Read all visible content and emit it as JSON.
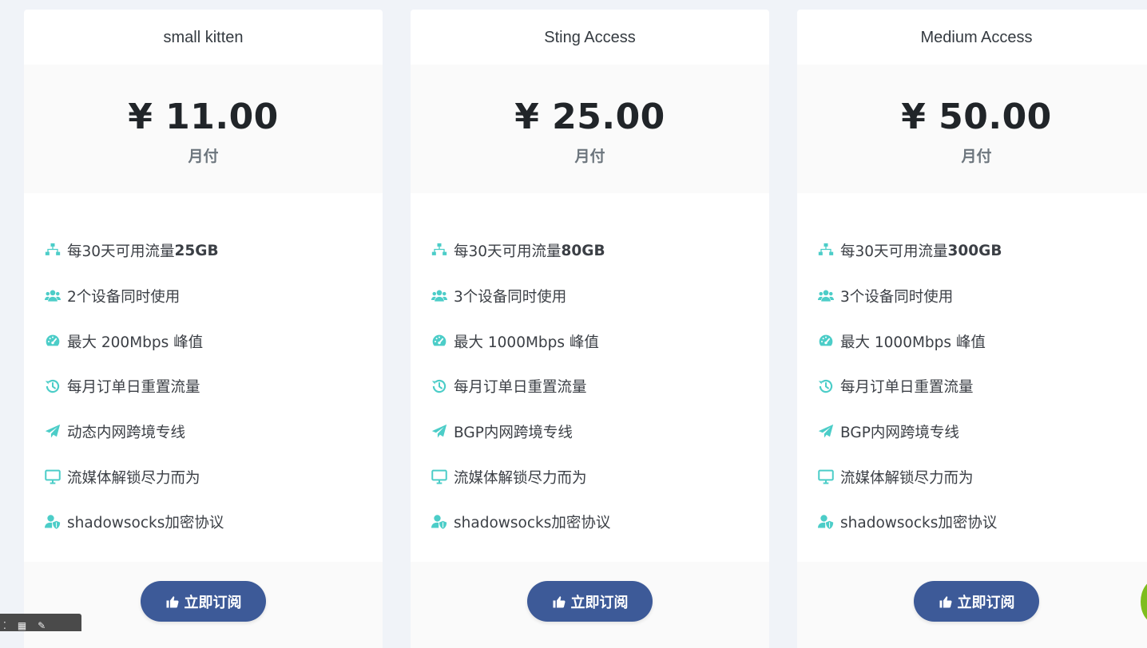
{
  "accent_color": "#4ccdc8",
  "button_color": "#3d5a98",
  "plans": [
    {
      "name": "small kitten",
      "price": "¥ 11.00",
      "period": "月付",
      "features": [
        {
          "icon": "network-icon",
          "text": "每30天可用流量",
          "bold": "25GB"
        },
        {
          "icon": "users-icon",
          "text": "2个设备同时使用",
          "bold": ""
        },
        {
          "icon": "speedometer-icon",
          "text": "最大 200Mbps 峰值",
          "bold": ""
        },
        {
          "icon": "history-icon",
          "text": "每月订单日重置流量",
          "bold": ""
        },
        {
          "icon": "paper-plane-icon",
          "text": "动态内网跨境专线",
          "bold": ""
        },
        {
          "icon": "monitor-icon",
          "text": "流媒体解锁尽力而为",
          "bold": ""
        },
        {
          "icon": "user-shield-icon",
          "text": "shadowsocks加密协议",
          "bold": ""
        }
      ],
      "button": "立即订阅"
    },
    {
      "name": "Sting Access",
      "price": "¥ 25.00",
      "period": "月付",
      "features": [
        {
          "icon": "network-icon",
          "text": "每30天可用流量",
          "bold": "80GB"
        },
        {
          "icon": "users-icon",
          "text": "3个设备同时使用",
          "bold": ""
        },
        {
          "icon": "speedometer-icon",
          "text": "最大 1000Mbps 峰值",
          "bold": ""
        },
        {
          "icon": "history-icon",
          "text": "每月订单日重置流量",
          "bold": ""
        },
        {
          "icon": "paper-plane-icon",
          "text": "BGP内网跨境专线",
          "bold": ""
        },
        {
          "icon": "monitor-icon",
          "text": "流媒体解锁尽力而为",
          "bold": ""
        },
        {
          "icon": "user-shield-icon",
          "text": "shadowsocks加密协议",
          "bold": ""
        }
      ],
      "button": "立即订阅"
    },
    {
      "name": "Medium Access",
      "price": "¥ 50.00",
      "period": "月付",
      "features": [
        {
          "icon": "network-icon",
          "text": "每30天可用流量",
          "bold": "300GB"
        },
        {
          "icon": "users-icon",
          "text": "3个设备同时使用",
          "bold": ""
        },
        {
          "icon": "speedometer-icon",
          "text": "最大 1000Mbps 峰值",
          "bold": ""
        },
        {
          "icon": "history-icon",
          "text": "每月订单日重置流量",
          "bold": ""
        },
        {
          "icon": "paper-plane-icon",
          "text": "BGP内网跨境专线",
          "bold": ""
        },
        {
          "icon": "monitor-icon",
          "text": "流媒体解锁尽力而为",
          "bold": ""
        },
        {
          "icon": "user-shield-icon",
          "text": "shadowsocks加密协议",
          "bold": ""
        }
      ],
      "button": "立即订阅"
    }
  ]
}
